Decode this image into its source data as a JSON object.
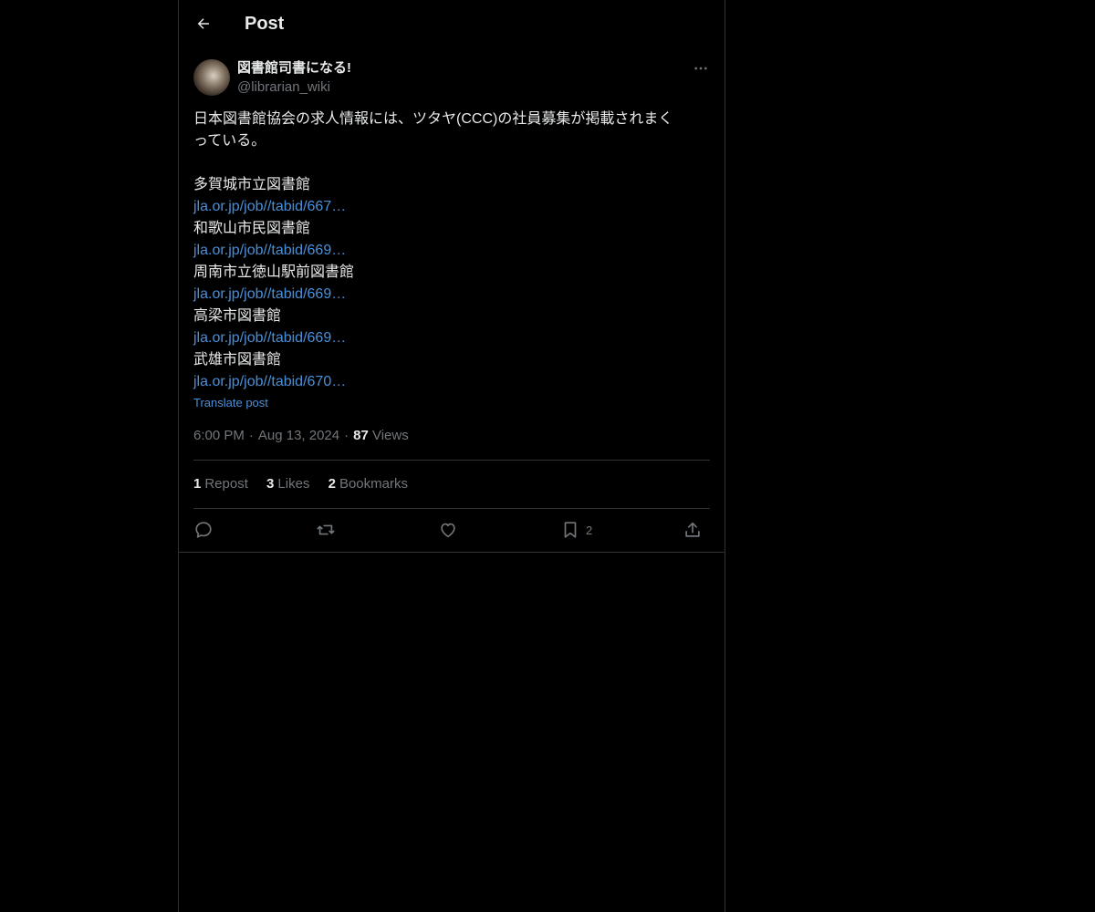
{
  "header": {
    "title": "Post",
    "back_icon": "arrow-left-icon"
  },
  "author": {
    "display_name": "図書館司書になる!",
    "handle": "@librarian_wiki"
  },
  "post": {
    "text_intro": "日本図書館協会の求人情報には、ツタヤ(CCC)の社員募集が掲載されまく",
    "text_intro_2": "っている。",
    "entries": [
      {
        "name": "多賀城市立図書館",
        "link": "jla.or.jp/job//tabid/667…"
      },
      {
        "name": "和歌山市民図書館",
        "link": "jla.or.jp/job//tabid/669…"
      },
      {
        "name": "周南市立徳山駅前図書館",
        "link": "jla.or.jp/job//tabid/669…"
      },
      {
        "name": "高梁市図書館",
        "link": "jla.or.jp/job//tabid/669…"
      },
      {
        "name": "武雄市図書館",
        "link": "jla.or.jp/job//tabid/670…"
      }
    ],
    "translate_label": "Translate post"
  },
  "meta": {
    "time": "6:00 PM",
    "separator": "·",
    "date": "Aug 13, 2024",
    "views_count": "87",
    "views_label": "Views"
  },
  "stats": {
    "reposts_count": "1",
    "reposts_label": "Repost",
    "likes_count": "3",
    "likes_label": "Likes",
    "bookmarks_count": "2",
    "bookmarks_label": "Bookmarks"
  },
  "actions": {
    "reply_icon": "reply-icon",
    "repost_icon": "repost-icon",
    "like_icon": "heart-icon",
    "bookmark_icon": "bookmark-icon",
    "bookmark_count": "2",
    "share_icon": "share-icon"
  },
  "colors": {
    "background": "#000000",
    "text": "#e7e9ea",
    "secondary_text": "#71767b",
    "link": "#4a90d9",
    "border": "#2f3336"
  }
}
